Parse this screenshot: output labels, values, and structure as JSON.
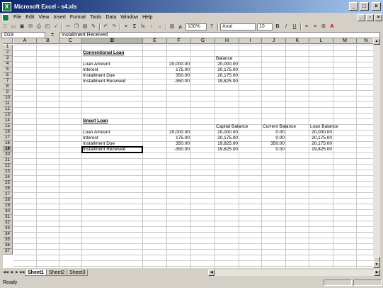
{
  "window": {
    "title": "Microsoft Excel - s4.xls",
    "app_icon": "X"
  },
  "menu": [
    "File",
    "Edit",
    "View",
    "Insert",
    "Format",
    "Tools",
    "Data",
    "Window",
    "Help"
  ],
  "toolbar": {
    "zoom": "100%",
    "font": "Arial",
    "size": "10",
    "bold": "B",
    "italic": "I",
    "underline": "U",
    "sum": "Σ",
    "fx": "fx",
    "help": "?"
  },
  "formula_bar": {
    "name_box": "D19",
    "equals": "=",
    "content": "Installment Received"
  },
  "columns": [
    "A",
    "B",
    "C",
    "D",
    "E",
    "F",
    "G",
    "H",
    "I",
    "J",
    "K",
    "L",
    "M",
    "N"
  ],
  "active_column": "D",
  "active_row": 19,
  "rows": [
    "1",
    "2",
    "3",
    "4",
    "5",
    "6",
    "7",
    "8",
    "9",
    "10",
    "11",
    "12",
    "13",
    "14",
    "15",
    "16",
    "17",
    "18",
    "19",
    "20",
    "21",
    "22",
    "23",
    "24",
    "25",
    "26",
    "27",
    "28",
    "29",
    "30",
    "31",
    "32",
    "33",
    "34",
    "35",
    "36",
    "37"
  ],
  "cells": {
    "d2": "Conventional Loan",
    "h3": "Balance",
    "d4": "Loan Amount",
    "f4": "20,000.00",
    "h4": "20,000.00",
    "d5": "Interest",
    "f5": "175.00",
    "h5": "20,175.00",
    "d6": "Installment Due",
    "f6": "350.00",
    "h6": "20,175.00",
    "d7": "Installment Received",
    "f7": "-350.00",
    "h7": "19,825.00",
    "d14": "Smart Loan",
    "h15": "Capital Balance",
    "j15": "Current Balance",
    "l15": "Loan Balance",
    "d16": "Loan Amount",
    "f16": "20,000.00",
    "h16": "20,000.00",
    "j16": "0.00",
    "l16": "20,000.00",
    "d17": "Interest",
    "f17": "175.00",
    "h17": "20,175.00",
    "j17": "0.00",
    "l17": "20,175.00",
    "d18": "Installment Due",
    "f18": "350.00",
    "h18": "19,825.00",
    "j18": "350.00",
    "l18": "20,175.00",
    "d19": "Installment Received",
    "f19": "-350.00",
    "h19": "19,825.00",
    "j19": "0.00",
    "l19": "19,825.00"
  },
  "sheets": [
    "Sheet1",
    "Sheet2",
    "Sheet3"
  ],
  "active_sheet": "Sheet1",
  "status": "Ready"
}
